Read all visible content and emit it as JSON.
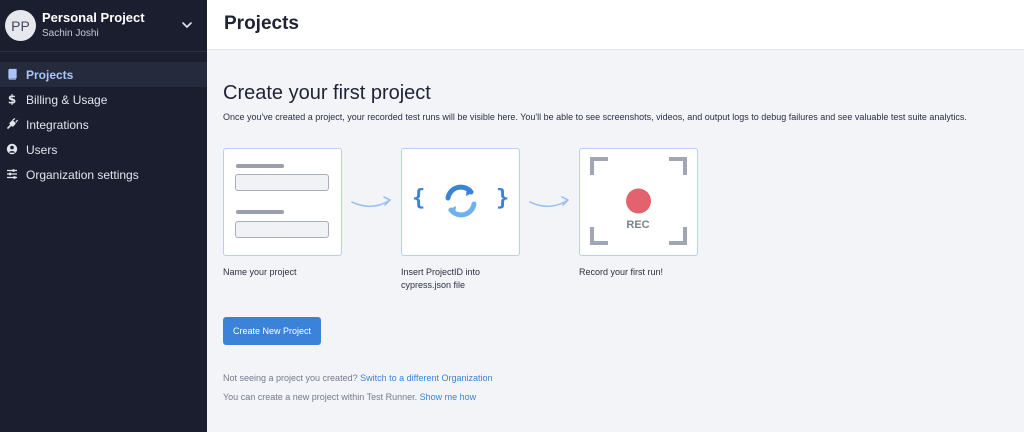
{
  "organization": {
    "avatar_initials": "PP",
    "name": "Personal Project",
    "user": "Sachin Joshi"
  },
  "sidebar": {
    "items": [
      {
        "label": "Projects",
        "icon": "book-icon",
        "active": true
      },
      {
        "label": "Billing & Usage",
        "icon": "dollar-icon",
        "active": false
      },
      {
        "label": "Integrations",
        "icon": "plug-icon",
        "active": false
      },
      {
        "label": "Users",
        "icon": "user-circle-icon",
        "active": false
      },
      {
        "label": "Organization settings",
        "icon": "sliders-icon",
        "active": false
      }
    ]
  },
  "header": {
    "title": "Projects"
  },
  "main": {
    "title": "Create your first project",
    "description": "Once you've created a project, your recorded test runs will be visible here. You'll be able to see screenshots, videos, and output logs to debug failures and see valuable test suite analytics.",
    "steps": [
      {
        "label": "Name your project"
      },
      {
        "label_line1": "Insert ProjectID into",
        "label_line2": "cypress.json file"
      },
      {
        "label": "Record your first run!",
        "rec_text": "REC"
      }
    ],
    "cta_label": "Create New Project",
    "hint1_text": "Not seeing a project you created?",
    "hint1_link": "Switch to a different Organization",
    "hint2_text": "You can create a new project within Test Runner.",
    "hint2_link": "Show me how",
    "brace_left": "{",
    "brace_right": "}"
  },
  "colors": {
    "sidebar_bg": "#1b1e2e",
    "accent": "#3b83d9",
    "active_nav_text": "#a9c6f7",
    "card_border": "#b7d0f3",
    "rec_dot": "#e2636e"
  }
}
